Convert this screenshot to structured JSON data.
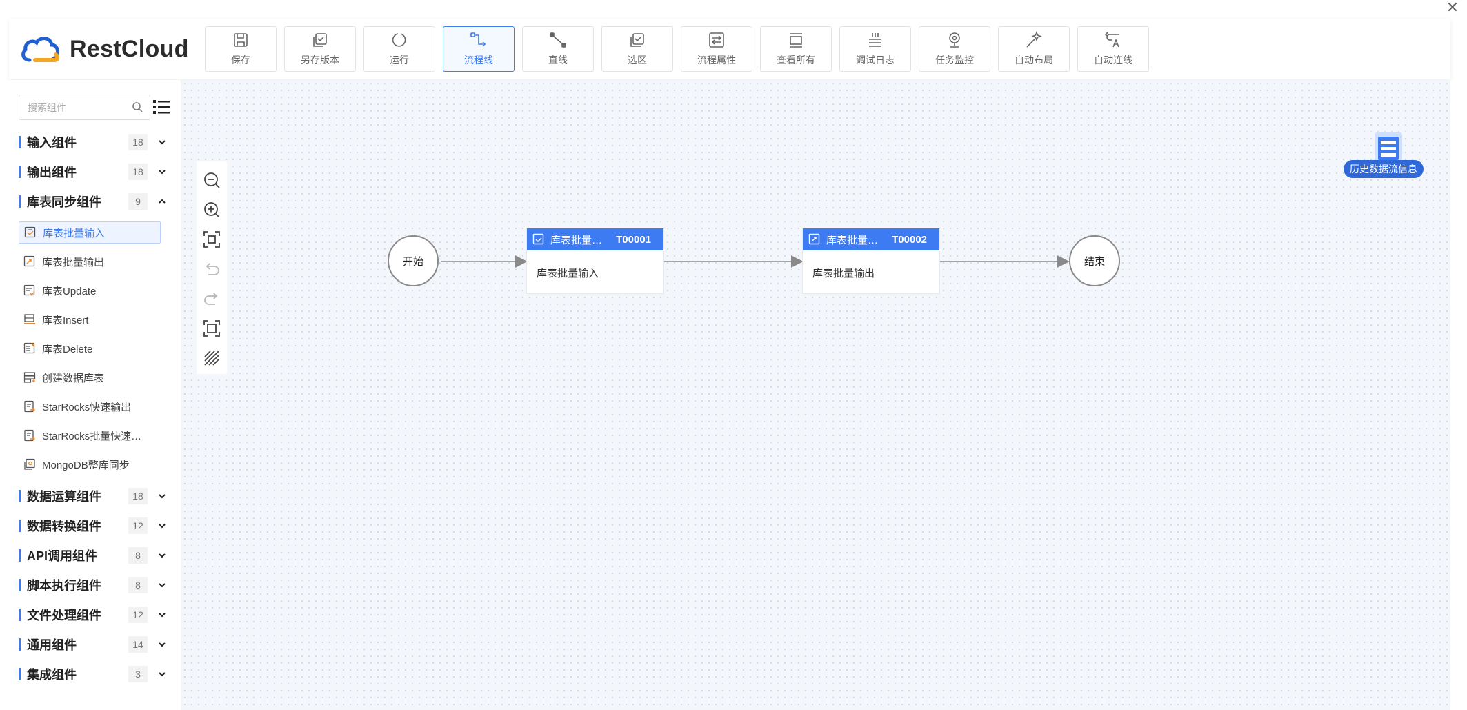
{
  "app": {
    "logo_text": "RestCloud"
  },
  "toolbar": [
    {
      "label": "保存",
      "icon": "save-icon"
    },
    {
      "label": "另存版本",
      "icon": "save-version-icon"
    },
    {
      "label": "运行",
      "icon": "run-icon"
    },
    {
      "label": "流程线",
      "icon": "flow-line-icon",
      "active": true
    },
    {
      "label": "直线",
      "icon": "straight-line-icon"
    },
    {
      "label": "选区",
      "icon": "selection-icon"
    },
    {
      "label": "流程属性",
      "icon": "flow-properties-icon"
    },
    {
      "label": "查看所有",
      "icon": "view-all-icon"
    },
    {
      "label": "调试日志",
      "icon": "debug-log-icon"
    },
    {
      "label": "任务监控",
      "icon": "task-monitor-icon"
    },
    {
      "label": "自动布局",
      "icon": "auto-layout-icon"
    },
    {
      "label": "自动连线",
      "icon": "auto-connect-icon"
    }
  ],
  "sidebar": {
    "search_placeholder": "搜索组件",
    "groups": [
      {
        "name": "输入组件",
        "count": "18",
        "expanded": false
      },
      {
        "name": "输出组件",
        "count": "18",
        "expanded": false
      },
      {
        "name": "库表同步组件",
        "count": "9",
        "expanded": true
      },
      {
        "name": "数据运算组件",
        "count": "18",
        "expanded": false
      },
      {
        "name": "数据转换组件",
        "count": "12",
        "expanded": false
      },
      {
        "name": "API调用组件",
        "count": "8",
        "expanded": false
      },
      {
        "name": "脚本执行组件",
        "count": "8",
        "expanded": false
      },
      {
        "name": "文件处理组件",
        "count": "12",
        "expanded": false
      },
      {
        "name": "通用组件",
        "count": "14",
        "expanded": false
      },
      {
        "name": "集成组件",
        "count": "3",
        "expanded": false
      }
    ],
    "items": [
      {
        "label": "库表批量输入",
        "selected": true
      },
      {
        "label": "库表批量输出"
      },
      {
        "label": "库表Update"
      },
      {
        "label": "库表Insert"
      },
      {
        "label": "库表Delete"
      },
      {
        "label": "创建数据库表"
      },
      {
        "label": "StarRocks快速输出"
      },
      {
        "label": "StarRocks批量快速…"
      },
      {
        "label": "MongoDB整库同步"
      }
    ]
  },
  "canvas": {
    "start_label": "开始",
    "end_label": "结束",
    "nodes": [
      {
        "title": "库表批量…",
        "id": "T00001",
        "body": "库表批量输入"
      },
      {
        "title": "库表批量…",
        "id": "T00002",
        "body": "库表批量输出"
      }
    ],
    "history_label": "历史数据流信息"
  },
  "colors": {
    "accent": "#3d7bf2",
    "badge": "#2f68d8"
  }
}
